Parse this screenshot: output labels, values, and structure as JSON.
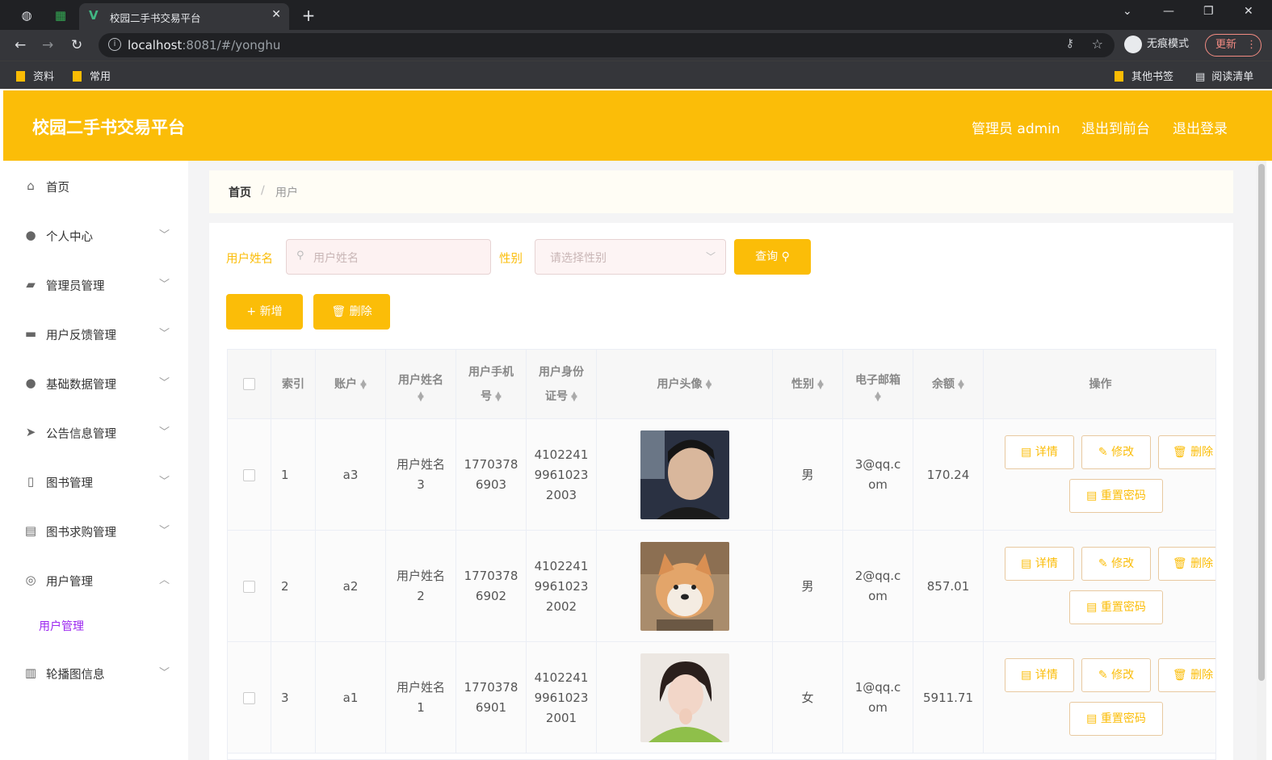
{
  "browser": {
    "tab_title": "校园二手书交易平台",
    "url_host": "localhost",
    "url_rest": ":8081/#/yonghu",
    "incognito_label": "无痕模式",
    "update_label": "更新",
    "bookmarks": [
      "资料",
      "常用"
    ],
    "other_bookmarks": "其他书签",
    "reading_list": "阅读清单"
  },
  "header": {
    "title": "校园二手书交易平台",
    "admin_label": "管理员 admin",
    "exit_front": "退出到前台",
    "logout": "退出登录"
  },
  "sidebar": {
    "items": [
      {
        "label": "首页",
        "icon": "home-icon"
      },
      {
        "label": "个人中心",
        "icon": "user-icon"
      },
      {
        "label": "管理员管理",
        "icon": "admin-icon"
      },
      {
        "label": "用户反馈管理",
        "icon": "briefcase-icon"
      },
      {
        "label": "基础数据管理",
        "icon": "leaf-icon"
      },
      {
        "label": "公告信息管理",
        "icon": "send-icon"
      },
      {
        "label": "图书管理",
        "icon": "book-icon"
      },
      {
        "label": "图书求购管理",
        "icon": "clipboard-icon"
      },
      {
        "label": "用户管理",
        "icon": "target-icon"
      },
      {
        "label": "轮播图信息",
        "icon": "bars-icon"
      }
    ],
    "sub_active": "用户管理"
  },
  "breadcrumb": {
    "home": "首页",
    "sep": "/",
    "current": "用户"
  },
  "search": {
    "name_label": "用户姓名",
    "name_placeholder": "用户姓名",
    "gender_label": "性别",
    "gender_placeholder": "请选择性别",
    "query_button": "查询"
  },
  "actions": {
    "add": "新增",
    "delete": "删除"
  },
  "table": {
    "headers": {
      "index": "索引",
      "account": "账户",
      "name_1": "用户姓名",
      "phone_1": "用户手机",
      "phone_2": "号",
      "idcard_1": "用户身份",
      "idcard_2": "证号",
      "avatar": "用户头像",
      "gender": "性别",
      "email": "电子邮箱",
      "balance": "余额",
      "ops": "操作"
    },
    "rows": [
      {
        "index": "1",
        "account": "a3",
        "name_1": "用户姓名",
        "name_2": "3",
        "phone_1": "1770378",
        "phone_2": "6903",
        "id_1": "4102241",
        "id_2": "9961023",
        "id_3": "2003",
        "gender": "男",
        "email_1": "3@qq.c",
        "email_2": "om",
        "balance": "170.24"
      },
      {
        "index": "2",
        "account": "a2",
        "name_1": "用户姓名",
        "name_2": "2",
        "phone_1": "1770378",
        "phone_2": "6902",
        "id_1": "4102241",
        "id_2": "9961023",
        "id_3": "2002",
        "gender": "男",
        "email_1": "2@qq.c",
        "email_2": "om",
        "balance": "857.01"
      },
      {
        "index": "3",
        "account": "a1",
        "name_1": "用户姓名",
        "name_2": "1",
        "phone_1": "1770378",
        "phone_2": "6901",
        "id_1": "4102241",
        "id_2": "9961023",
        "id_3": "2001",
        "gender": "女",
        "email_1": "1@qq.c",
        "email_2": "om",
        "balance": "5911.71"
      }
    ],
    "op_labels": {
      "detail": "详情",
      "edit": "修改",
      "delete": "删除",
      "reset": "重置密码"
    }
  },
  "colors": {
    "accent": "#fbbd08",
    "sub_active": "#9c27f0"
  }
}
